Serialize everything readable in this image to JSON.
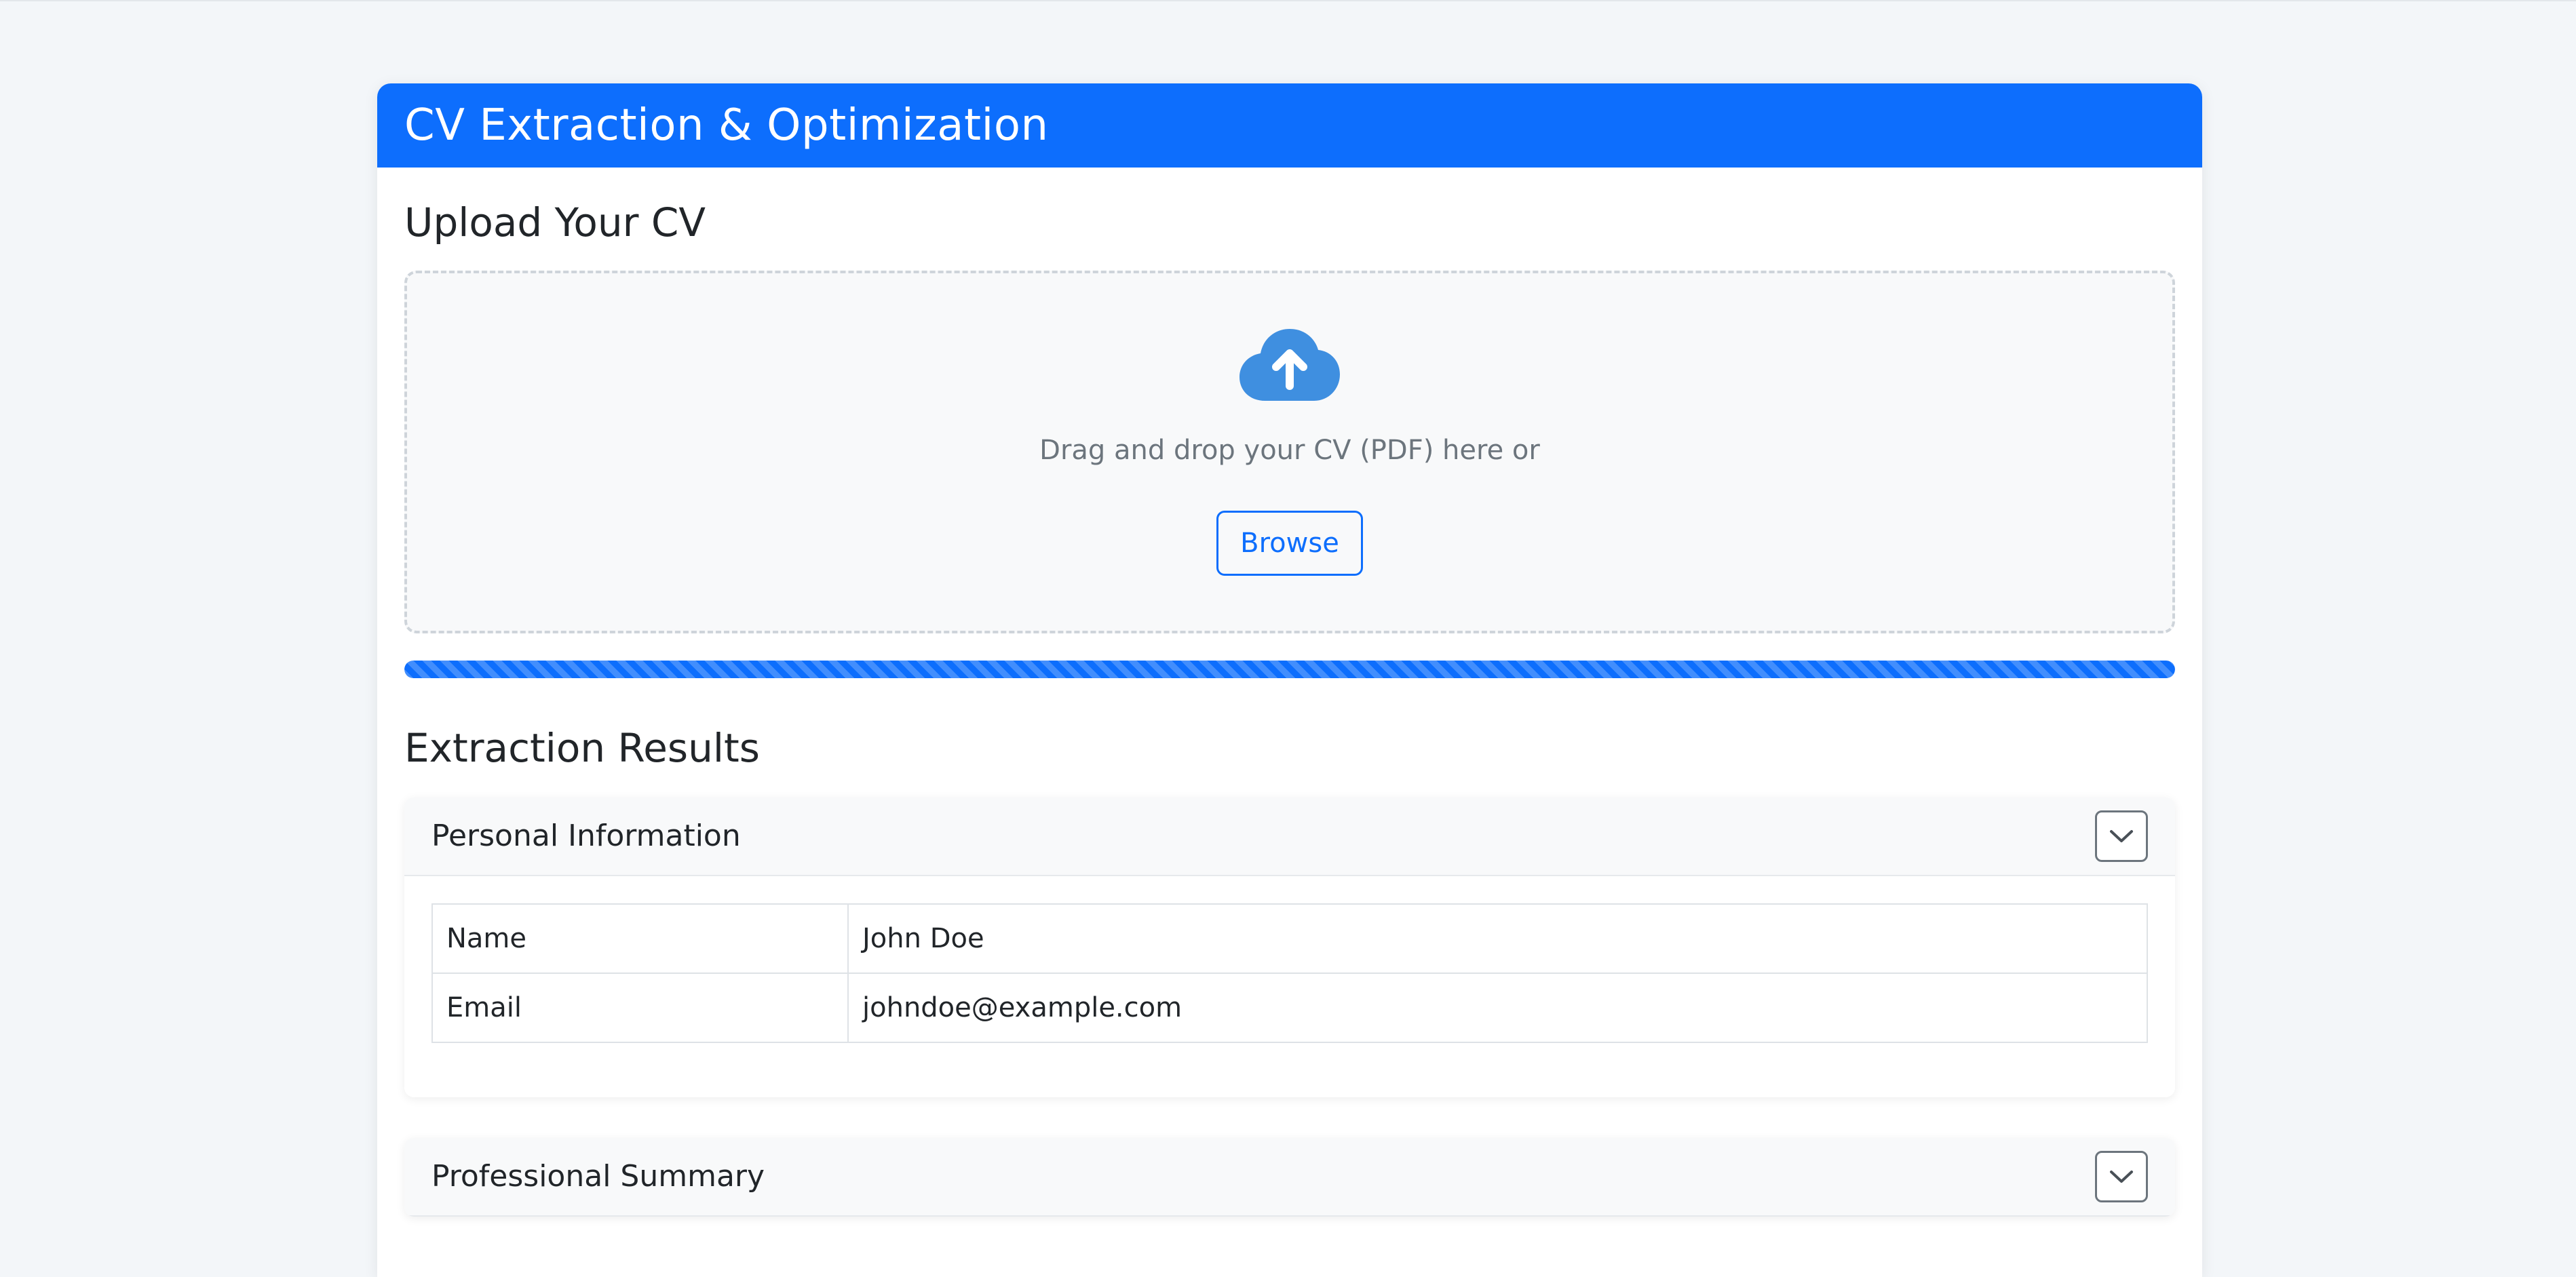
{
  "app": {
    "title": "CV Extraction & Optimization"
  },
  "upload": {
    "heading": "Upload Your CV",
    "icon": "cloud-upload-icon",
    "drop_text": "Drag and drop your CV (PDF) here or",
    "browse_label": "Browse"
  },
  "progress": {
    "percent": 100,
    "style": "striped-animated"
  },
  "results": {
    "heading": "Extraction Results",
    "sections": [
      {
        "title": "Personal Information",
        "toggle_icon": "chevron-down-icon",
        "rows": [
          {
            "key": "Name",
            "value": "John Doe"
          },
          {
            "key": "Email",
            "value": "johndoe@example.com"
          }
        ]
      },
      {
        "title": "Professional Summary",
        "toggle_icon": "chevron-down-icon",
        "rows": []
      }
    ]
  },
  "colors": {
    "primary": "#0d6efd",
    "icon_blue": "#3f8fe0",
    "muted": "#6c757d",
    "background": "#f3f6f9"
  }
}
